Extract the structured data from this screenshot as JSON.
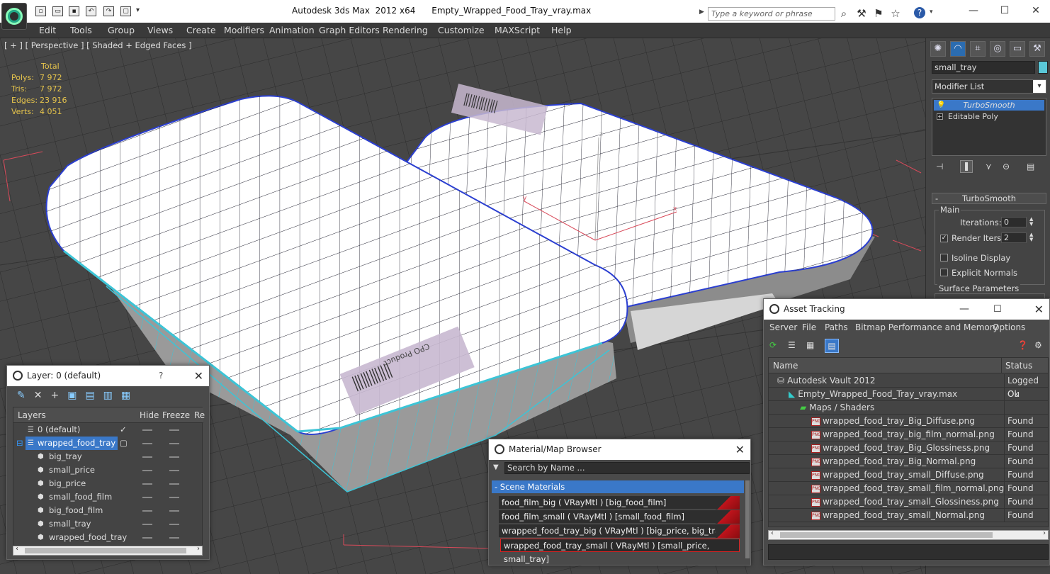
{
  "app": {
    "title": "Autodesk 3ds Max  2012 x64      Empty_Wrapped_Food_Tray_vray.max",
    "search_placeholder": "Type a keyword or phrase"
  },
  "menu": [
    "Edit",
    "Tools",
    "Group",
    "Views",
    "Create",
    "Modifiers",
    "Animation",
    "Graph Editors",
    "Rendering",
    "Customize",
    "MAXScript",
    "Help"
  ],
  "viewport": {
    "label": "[ + ] [ Perspective ] [ Shaded + Edged Faces ]",
    "stats": {
      "header": "Total",
      "rows": [
        {
          "label": "Polys:",
          "value": "7 972"
        },
        {
          "label": "Tris:",
          "value": "7 972"
        },
        {
          "label": "Edges:",
          "value": "23 916"
        },
        {
          "label": "Verts:",
          "value": "4 051"
        }
      ]
    },
    "label_text": "CPO Product"
  },
  "command_panel": {
    "object_name": "small_tray",
    "object_color": "#5ac8d8",
    "modifier_list": "Modifier List",
    "stack": [
      "TurboSmooth",
      "Editable Poly"
    ],
    "rollout_title": "TurboSmooth",
    "group_main": "Main",
    "iterations_label": "Iterations:",
    "iterations_value": "0",
    "render_iters_label": "Render Iters:",
    "render_iters_value": "2",
    "render_iters_checked": true,
    "isoline_label": "Isoline Display",
    "explicit_normals_label": "Explicit Normals",
    "surface_params_label": "Surface Parameters"
  },
  "layer_window": {
    "title": "Layer: 0 (default)",
    "help": "?",
    "columns": [
      "Layers",
      "Hide",
      "Freeze",
      "Re"
    ],
    "rows": [
      {
        "name": "0 (default)",
        "level": 0,
        "checked": true
      },
      {
        "name": "wrapped_food_tray",
        "level": 0,
        "selected": true
      },
      {
        "name": "big_tray",
        "level": 1
      },
      {
        "name": "small_price",
        "level": 1
      },
      {
        "name": "big_price",
        "level": 1
      },
      {
        "name": "small_food_film",
        "level": 1
      },
      {
        "name": "big_food_film",
        "level": 1
      },
      {
        "name": "small_tray",
        "level": 1
      },
      {
        "name": "wrapped_food_tray",
        "level": 1
      }
    ]
  },
  "asset_tracking": {
    "title": "Asset Tracking",
    "menu": [
      "Server",
      "File",
      "Paths",
      "Bitmap Performance and Memory",
      "Options"
    ],
    "columns": [
      "Name",
      "Status"
    ],
    "rows": [
      {
        "name": "Autodesk Vault 2012",
        "status": "Logged Ou",
        "indent": 1,
        "icon": "vault"
      },
      {
        "name": "Empty_Wrapped_Food_Tray_vray.max",
        "status": "Ok",
        "indent": 2,
        "icon": "max"
      },
      {
        "name": "Maps / Shaders",
        "status": "",
        "indent": 3,
        "icon": "maps"
      },
      {
        "name": "wrapped_food_tray_Big_Diffuse.png",
        "status": "Found",
        "indent": 4,
        "icon": "png"
      },
      {
        "name": "wrapped_food_tray_big_film_normal.png",
        "status": "Found",
        "indent": 4,
        "icon": "png"
      },
      {
        "name": "wrapped_food_tray_Big_Glossiness.png",
        "status": "Found",
        "indent": 4,
        "icon": "png"
      },
      {
        "name": "wrapped_food_tray_Big_Normal.png",
        "status": "Found",
        "indent": 4,
        "icon": "png"
      },
      {
        "name": "wrapped_food_tray_small_Diffuse.png",
        "status": "Found",
        "indent": 4,
        "icon": "png"
      },
      {
        "name": "wrapped_food_tray_small_film_normal.png",
        "status": "Found",
        "indent": 4,
        "icon": "png"
      },
      {
        "name": "wrapped_food_tray_small_Glossiness.png",
        "status": "Found",
        "indent": 4,
        "icon": "png"
      },
      {
        "name": "wrapped_food_tray_small_Normal.png",
        "status": "Found",
        "indent": 4,
        "icon": "png"
      }
    ]
  },
  "material_browser": {
    "title": "Material/Map Browser",
    "search_placeholder": "Search by Name ...",
    "section": "- Scene Materials",
    "rows": [
      "food_film_big  ( VRayMtl ) [big_food_film]",
      "food_film_small  ( VRayMtl ) [small_food_film]",
      "wrapped_food_tray_big  ( VRayMtl ) [big_price, big_tray]",
      "wrapped_food_tray_small  ( VRayMtl ) [small_price, small_tray]"
    ]
  }
}
